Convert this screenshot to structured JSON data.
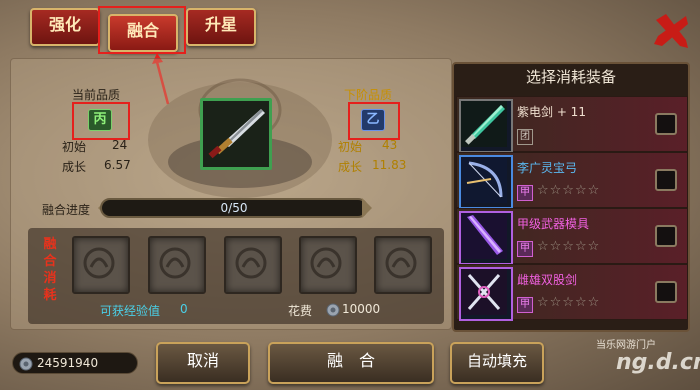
{
  "tabs": [
    {
      "label": "强化",
      "active": false
    },
    {
      "label": "融合",
      "active": true
    },
    {
      "label": "升星",
      "active": false
    }
  ],
  "current_quality": {
    "title": "当前品质",
    "grade": "丙",
    "initial_label": "初始",
    "initial": "24",
    "growth_label": "成长",
    "growth": "6.57"
  },
  "next_quality": {
    "title": "下阶品质",
    "grade": "乙",
    "initial_label": "初始",
    "initial": "43",
    "growth_label": "成长",
    "growth": "11.83"
  },
  "progress": {
    "label": "融合进度",
    "text": "0/50",
    "value": 0,
    "max": 50
  },
  "consume": {
    "label_chars": [
      "融",
      "合",
      "消",
      "耗"
    ],
    "exp_label": "可获经验值",
    "exp_value": "0",
    "cost_label": "花费",
    "cost_value": "10000"
  },
  "equipment_panel": {
    "title": "选择消耗装备",
    "items": [
      {
        "name": "紫电剑 + 11",
        "name_color": "#f0e0d0",
        "tag": "团",
        "stars": "",
        "icon": "jade-sword-icon"
      },
      {
        "name": "李广灵宝弓",
        "name_color": "#5ab8f0",
        "tag": "甲",
        "stars": "☆☆☆☆☆",
        "icon": "bow-icon"
      },
      {
        "name": "甲级武器模具",
        "name_color": "#f060e0",
        "tag": "甲",
        "stars": "☆☆☆☆☆",
        "icon": "purple-blade-icon"
      },
      {
        "name": "雌雄双股剑",
        "name_color": "#f060e0",
        "tag": "甲",
        "stars": "☆☆☆☆☆",
        "icon": "twin-swords-icon"
      }
    ]
  },
  "money": "24591940",
  "buttons": {
    "cancel": "取消",
    "fuse": "融　合",
    "autofill": "自动填充"
  },
  "watermark": {
    "site": "当乐网游门户",
    "domain": "ng.d.cn"
  },
  "colors": {
    "tab_red": "#a62a22",
    "gold_text": "#b08000",
    "highlight_red": "#e5201c"
  }
}
